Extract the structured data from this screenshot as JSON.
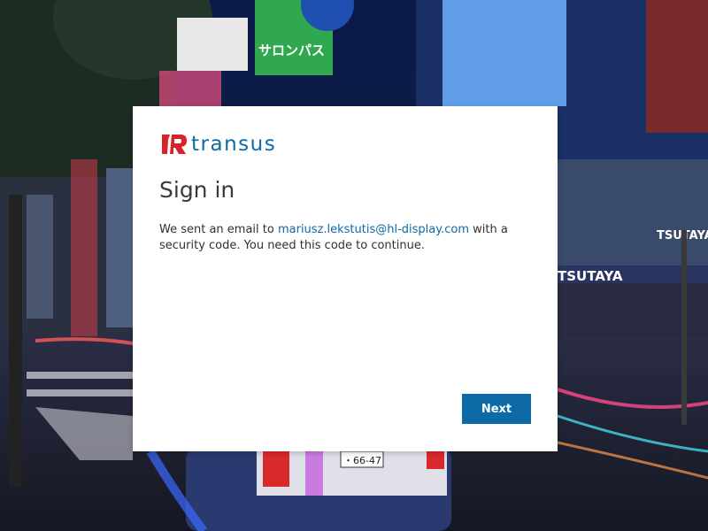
{
  "logo": {
    "text": "transus"
  },
  "title": "Sign in",
  "message": {
    "prefix": "We sent an email to ",
    "email": "mariusz.lekstutis@hl-display.com",
    "suffix": " with a security code. You need this code to continue."
  },
  "buttons": {
    "next_label": "Next"
  },
  "background": {
    "sign_1": "サロンパス",
    "sign_2": "TSUTAYA",
    "sign_3": "TSUTAYA",
    "plate": "・66-47"
  },
  "colors": {
    "accent": "#0e6aa6",
    "logo_red": "#d8232a"
  }
}
